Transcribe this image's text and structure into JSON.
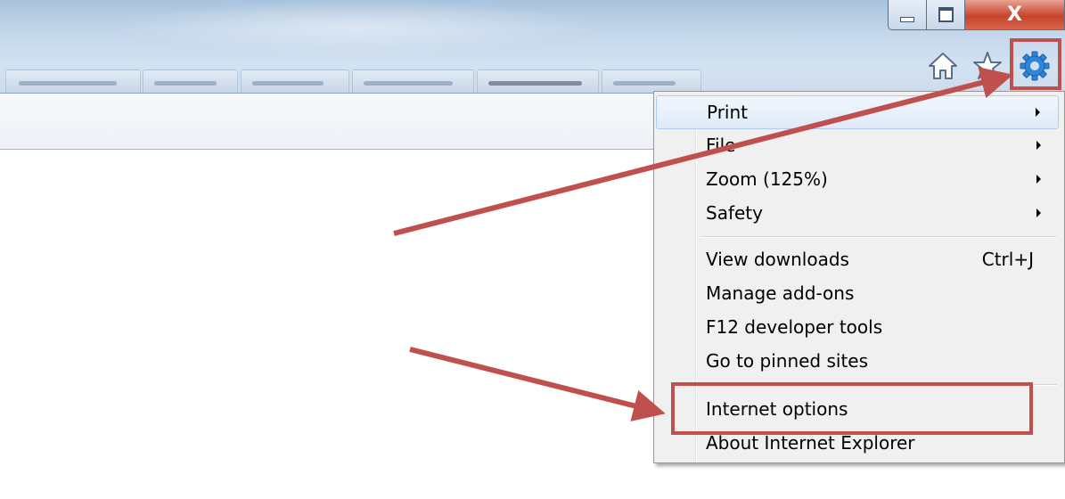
{
  "window": {
    "close_label": "X"
  },
  "toolbar": {
    "icons": [
      "home-icon",
      "star-icon",
      "gear-icon"
    ]
  },
  "menu": {
    "items": [
      {
        "label": "Print",
        "has_submenu": true,
        "shortcut": ""
      },
      {
        "label": "File",
        "has_submenu": true,
        "shortcut": ""
      },
      {
        "label": "Zoom (125%)",
        "has_submenu": true,
        "shortcut": ""
      },
      {
        "label": "Safety",
        "has_submenu": true,
        "shortcut": ""
      },
      {
        "label": "View downloads",
        "has_submenu": false,
        "shortcut": "Ctrl+J"
      },
      {
        "label": "Manage add-ons",
        "has_submenu": false,
        "shortcut": ""
      },
      {
        "label": "F12 developer tools",
        "has_submenu": false,
        "shortcut": ""
      },
      {
        "label": "Go to pinned sites",
        "has_submenu": false,
        "shortcut": ""
      },
      {
        "label": "Internet options",
        "has_submenu": false,
        "shortcut": ""
      },
      {
        "label": "About Internet Explorer",
        "has_submenu": false,
        "shortcut": ""
      }
    ]
  },
  "colors": {
    "annotation": "#c0504d",
    "gear": "#2f86d6"
  }
}
